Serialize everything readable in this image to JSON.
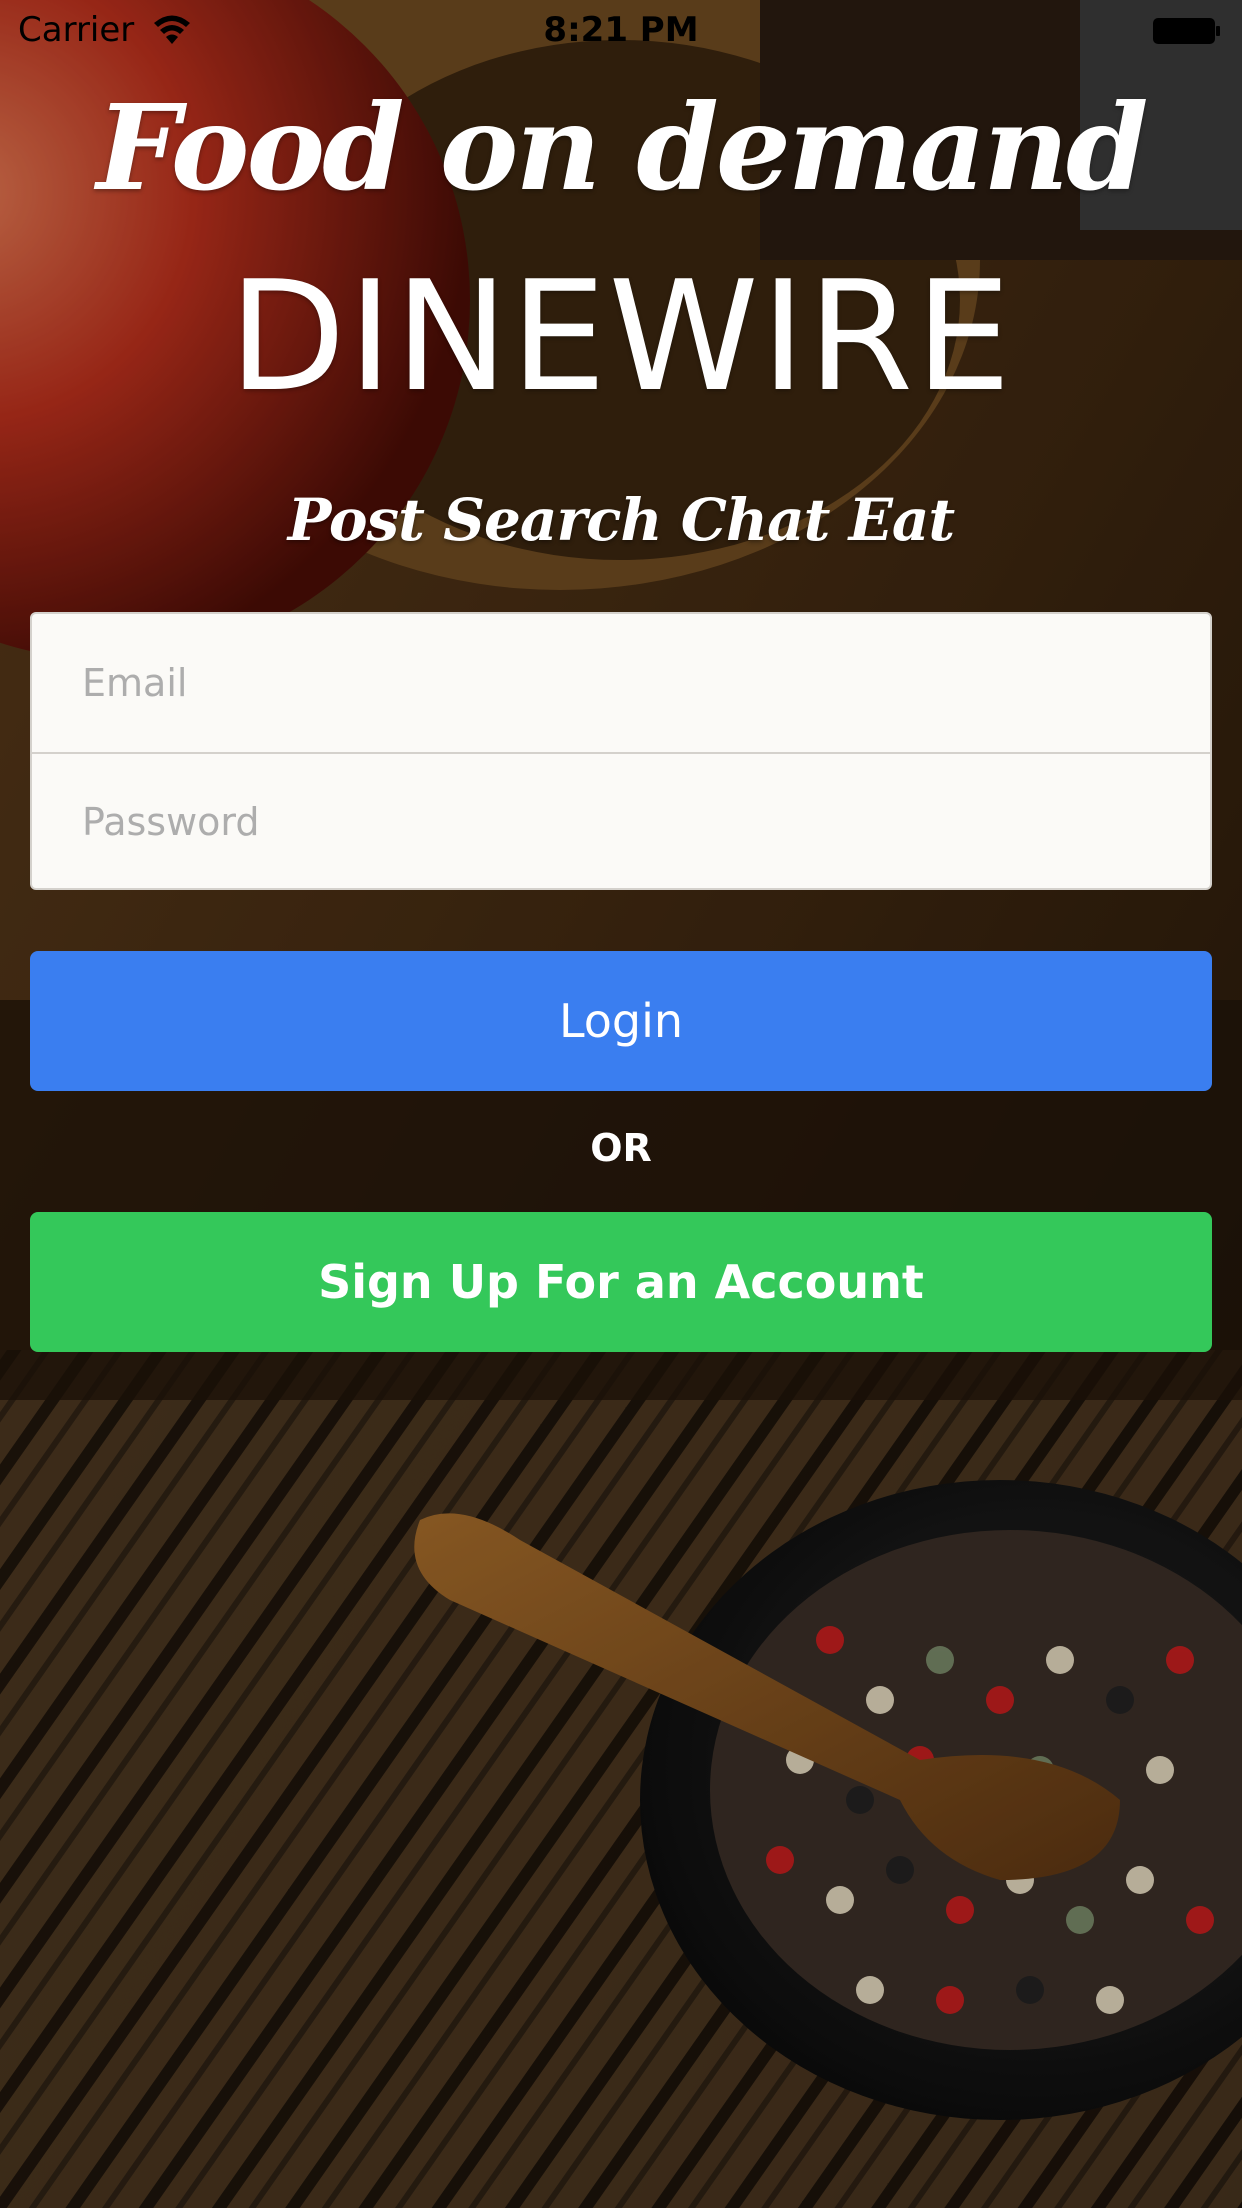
{
  "status_bar": {
    "carrier": "Carrier",
    "time": "8:21 PM",
    "wifi_icon": "wifi-icon",
    "battery_icon": "battery-icon"
  },
  "header": {
    "tagline": "Food on demand",
    "brand": "DINEWIRE",
    "subtitle": "Post Search Chat Eat"
  },
  "form": {
    "email_value": "",
    "email_placeholder": "Email",
    "password_value": "",
    "password_placeholder": "Password"
  },
  "actions": {
    "login_label": "Login",
    "or_label": "OR",
    "signup_label": "Sign Up For an Account"
  },
  "colors": {
    "login_button": "#3a7ef0",
    "signup_button": "#34c85a",
    "text_light": "#ffffff",
    "field_background": "#fbfaf7"
  }
}
